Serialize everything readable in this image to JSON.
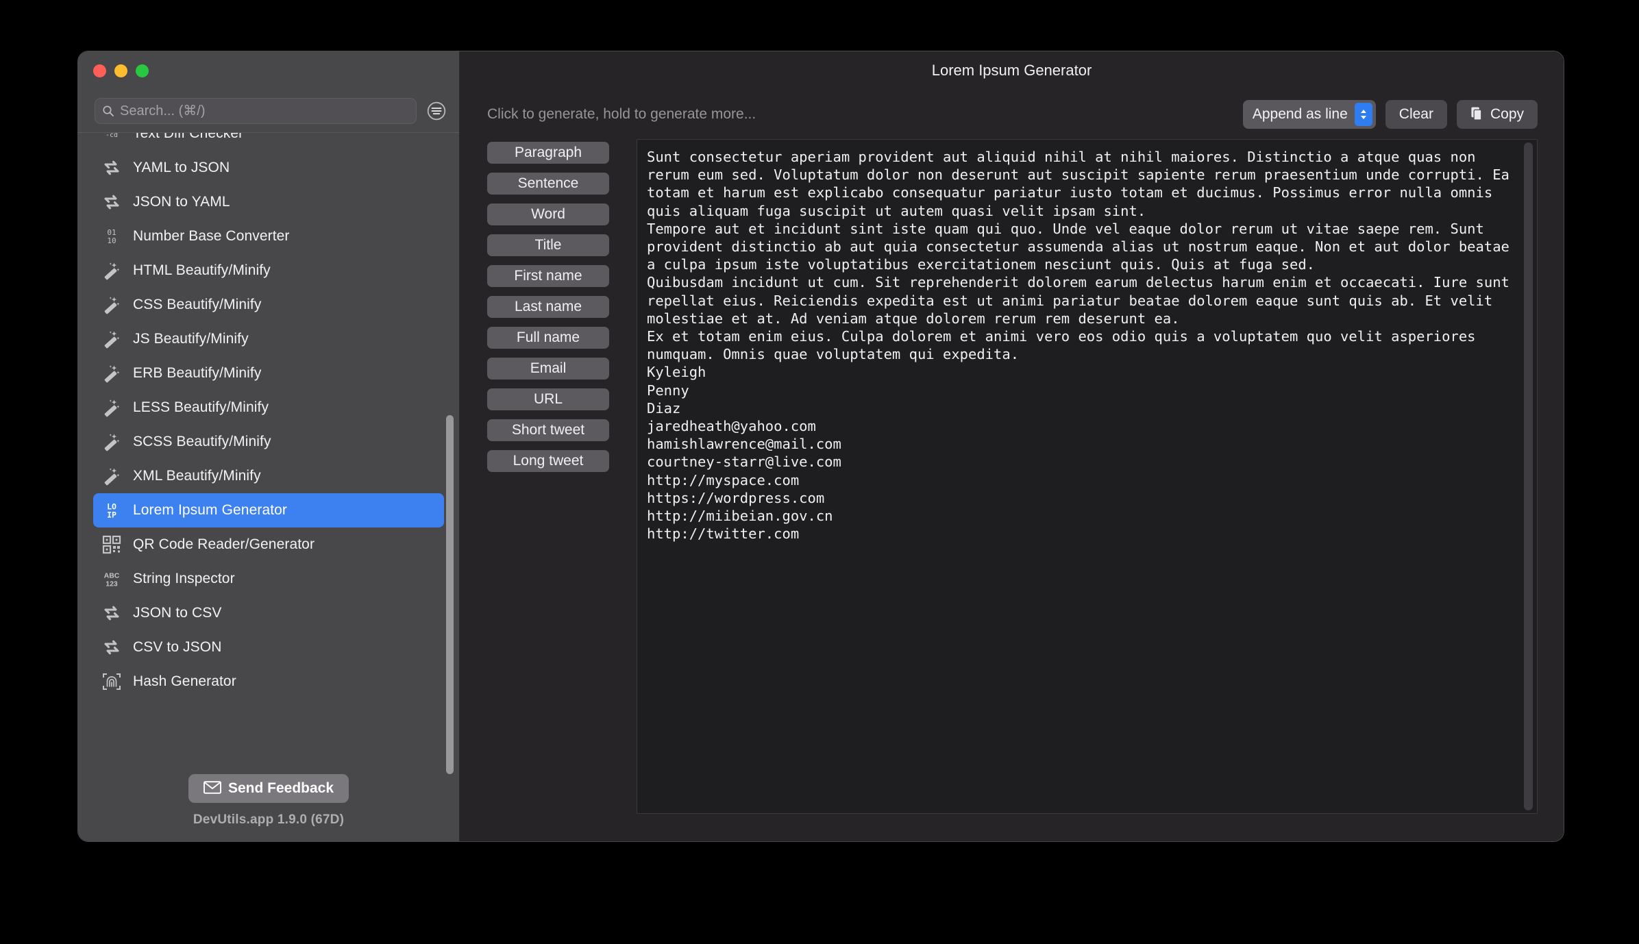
{
  "window": {
    "traffic_lights": [
      "close",
      "minimize",
      "zoom"
    ],
    "title": "Lorem Ipsum Generator"
  },
  "sidebar": {
    "search": {
      "placeholder": "Search... (⌘/)",
      "value": "",
      "icon": "search-icon"
    },
    "filter_icon": "filter-list-icon",
    "items": [
      {
        "label": "Text Diff Checker",
        "icon": "diff-icon",
        "selected": false,
        "clipped": true
      },
      {
        "label": "YAML to JSON",
        "icon": "swap-arrows-icon",
        "selected": false
      },
      {
        "label": "JSON to YAML",
        "icon": "swap-arrows-icon",
        "selected": false
      },
      {
        "label": "Number Base Converter",
        "icon": "binary-icon",
        "selected": false
      },
      {
        "label": "HTML Beautify/Minify",
        "icon": "magic-wand-icon",
        "selected": false
      },
      {
        "label": "CSS Beautify/Minify",
        "icon": "magic-wand-icon",
        "selected": false
      },
      {
        "label": "JS Beautify/Minify",
        "icon": "magic-wand-icon",
        "selected": false
      },
      {
        "label": "ERB Beautify/Minify",
        "icon": "magic-wand-icon",
        "selected": false
      },
      {
        "label": "LESS Beautify/Minify",
        "icon": "magic-wand-icon",
        "selected": false
      },
      {
        "label": "SCSS Beautify/Minify",
        "icon": "magic-wand-icon",
        "selected": false
      },
      {
        "label": "XML Beautify/Minify",
        "icon": "magic-wand-icon",
        "selected": false
      },
      {
        "label": "Lorem Ipsum Generator",
        "icon": "lorem-ipsum-icon",
        "selected": true
      },
      {
        "label": "QR Code Reader/Generator",
        "icon": "qr-code-icon",
        "selected": false
      },
      {
        "label": "String Inspector",
        "icon": "abc123-icon",
        "selected": false
      },
      {
        "label": "JSON to CSV",
        "icon": "swap-arrows-icon",
        "selected": false
      },
      {
        "label": "CSV to JSON",
        "icon": "swap-arrows-icon",
        "selected": false
      },
      {
        "label": "Hash Generator",
        "icon": "fingerprint-icon",
        "selected": false
      }
    ],
    "footer": {
      "feedback_label": "Send Feedback",
      "feedback_icon": "envelope-icon",
      "version": "DevUtils.app 1.9.0 (67D)"
    },
    "selection_color": "#3d81f0"
  },
  "main": {
    "title": "Lorem Ipsum Generator",
    "hint": "Click to generate, hold to generate more...",
    "mode_popup": {
      "label": "Append as line",
      "icon": "stepper-updown-icon",
      "accent": "#2f7df0"
    },
    "clear_label": "Clear",
    "copy_label": "Copy",
    "copy_icon": "copy-documents-icon",
    "generators": [
      "Paragraph",
      "Sentence",
      "Word",
      "Title",
      "First name",
      "Last name",
      "Full name",
      "Email",
      "URL",
      "Short tweet",
      "Long tweet"
    ],
    "output": "Sunt consectetur aperiam provident aut aliquid nihil at nihil maiores. Distinctio a atque quas non rerum eum sed. Voluptatum dolor non deserunt aut suscipit sapiente rerum praesentium unde corrupti. Ea totam et harum est explicabo consequatur pariatur iusto totam et ducimus. Possimus error nulla omnis quis aliquam fuga suscipit ut autem quasi velit ipsam sint.\nTempore aut et incidunt sint iste quam qui quo. Unde vel eaque dolor rerum ut vitae saepe rem. Sunt provident distinctio ab aut quia consectetur assumenda alias ut nostrum eaque. Non et aut dolor beatae a culpa ipsum iste voluptatibus exercitationem nesciunt quis. Quis at fuga sed.\nQuibusdam incidunt ut cum. Sit reprehenderit dolorem earum delectus harum enim et occaecati. Iure sunt repellat eius. Reiciendis expedita est ut animi pariatur beatae dolorem eaque sunt quis ab. Et velit molestiae et at. Ad veniam atque dolorem rerum rem deserunt ea.\nEx et totam enim eius. Culpa dolorem et animi vero eos odio quis a voluptatem quo velit asperiores numquam. Omnis quae voluptatem qui expedita.\nKyleigh\nPenny\nDiaz\njaredheath@yahoo.com\nhamishlawrence@mail.com\ncourtney-starr@live.com\nhttp://myspace.com\nhttps://wordpress.com\nhttp://miibeian.gov.cn\nhttp://twitter.com"
  }
}
